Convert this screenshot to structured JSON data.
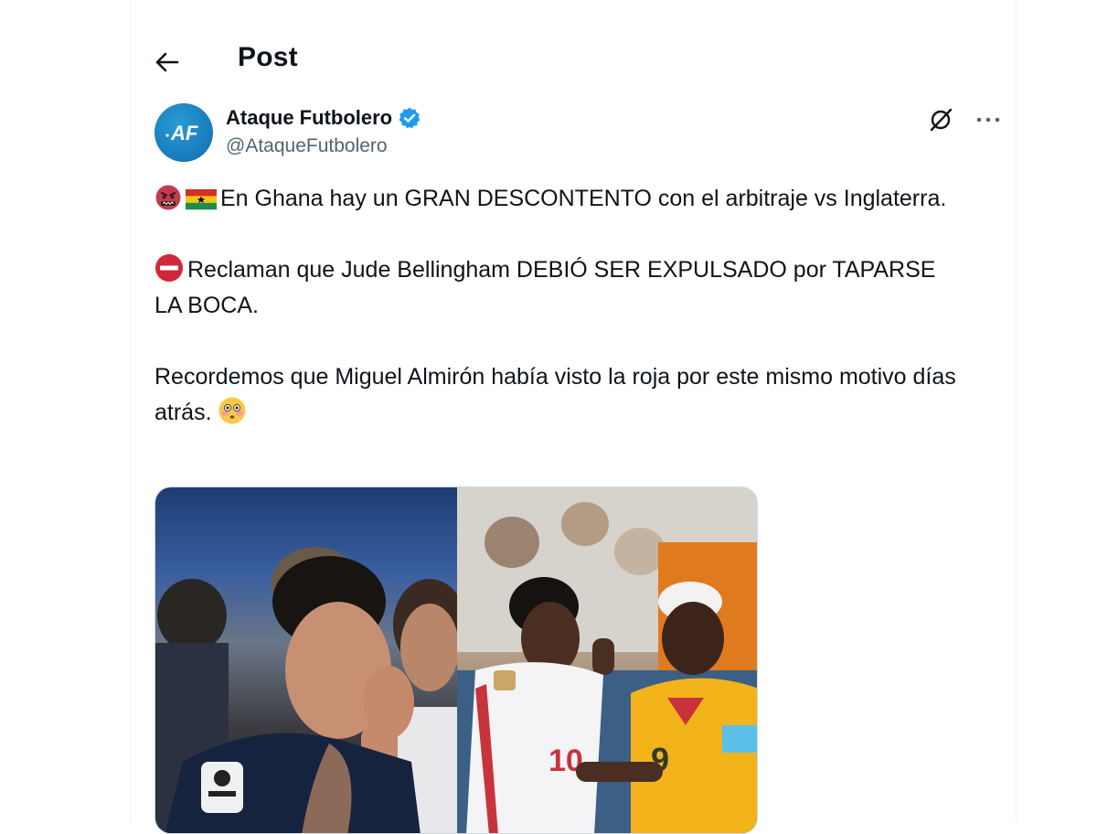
{
  "header": {
    "title": "Post",
    "back_icon": "arrow-left-icon"
  },
  "author": {
    "display_name": "Ataque Futbolero",
    "handle": "@AtaqueFutbolero",
    "avatar_text": "AF",
    "verified_color": "#1d9bf0",
    "avatar_color": "#1a7fbf"
  },
  "actions": {
    "grok_icon": "grok-icon",
    "more_icon": "more-icon"
  },
  "tweet": {
    "paragraphs": [
      {
        "emojis": [
          "angry-face-emoji",
          "ghana-flag-emoji"
        ],
        "text": "En Ghana hay un GRAN DESCONTENTO con el arbitraje vs Inglaterra."
      },
      {
        "emojis": [
          "no-entry-emoji"
        ],
        "text": "Reclaman que Jude Bellingham DEBIÓ SER EXPULSADO por TAPARSE LA BOCA."
      },
      {
        "text": "Recordemos que Miguel Almirón había visto la roja por este mismo motivo días atrás.",
        "trailing_emoji": "flushed-face-emoji"
      }
    ]
  },
  "media": {
    "left_photo": "player covering mouth photo",
    "right_photo": "two players talking photo"
  }
}
